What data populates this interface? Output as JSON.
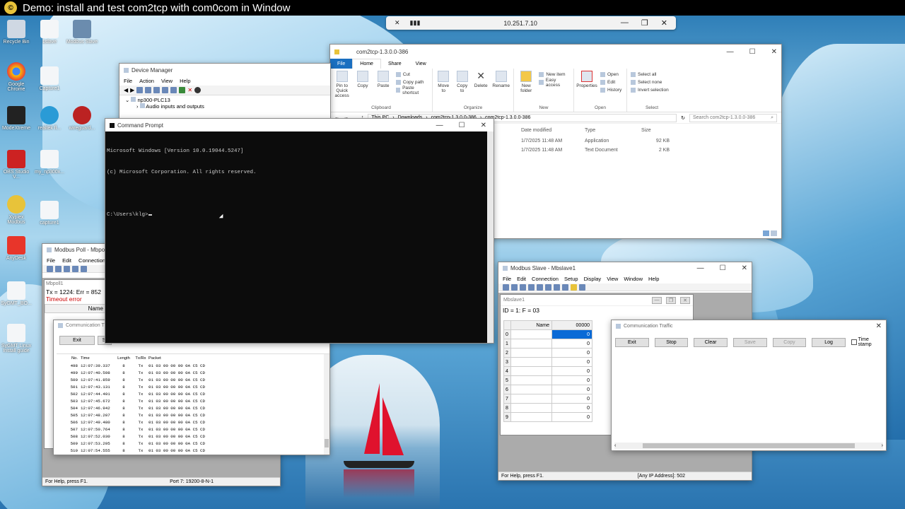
{
  "video_title": "Demo: install and test com2tcp with com0com in Window",
  "vpn_bar": {
    "ip": "10.251.7.10"
  },
  "desktop_icons": [
    {
      "label": "Recycle Bin"
    },
    {
      "label": "1slave"
    },
    {
      "label": "Modbus Slave"
    },
    {
      "label": "Google Chrome"
    },
    {
      "label": "Capture1"
    },
    {
      "label": "ModeXtreme"
    },
    {
      "label": "realtek fl..."
    },
    {
      "label": "wireguard..."
    },
    {
      "label": "OBS Studio V..."
    },
    {
      "label": "my_np300x..."
    },
    {
      "label": "Xyplex Modbus"
    },
    {
      "label": "capture1"
    },
    {
      "label": "AnyDesk"
    },
    {
      "label": "SyGMT_BO..."
    },
    {
      "label": "SyGMT Linux Install guide"
    }
  ],
  "device_manager": {
    "title": "Device Manager",
    "menu": [
      "File",
      "Action",
      "View",
      "Help"
    ],
    "tree": [
      "np300-PLC13",
      "Audio inputs and outputs"
    ]
  },
  "cmd": {
    "title": "Command Prompt",
    "lines": [
      "Microsoft Windows [Version 10.0.19044.5247]",
      "(c) Microsoft Corporation. All rights reserved.",
      "",
      "C:\\Users\\klg>"
    ]
  },
  "explorer": {
    "title": "com2tcp-1.3.0.0-386",
    "tabs": [
      "File",
      "Home",
      "Share",
      "View"
    ],
    "ribbon": {
      "clipboard": {
        "name": "Clipboard",
        "pin": "Pin to Quick access",
        "copy": "Copy",
        "paste": "Paste",
        "cut": "Cut",
        "copy_path": "Copy path",
        "paste_shortcut": "Paste shortcut"
      },
      "organize": {
        "name": "Organize",
        "move": "Move to",
        "copy": "Copy to",
        "delete": "Delete",
        "rename": "Rename"
      },
      "new": {
        "name": "New",
        "new_folder": "New folder",
        "new_item": "New item",
        "easy_access": "Easy access"
      },
      "open": {
        "name": "Open",
        "properties": "Properties",
        "open": "Open",
        "edit": "Edit",
        "history": "History"
      },
      "select": {
        "name": "Select",
        "all": "Select all",
        "none": "Select none",
        "invert": "Invert selection"
      }
    },
    "breadcrumb": [
      "This PC",
      "Downloads",
      "com2tcp-1.3.0.0-386",
      "com2tcp-1.3.0.0-386"
    ],
    "search_placeholder": "Search com2tcp-1.3.0.0-386",
    "columns": [
      "Date modified",
      "Type",
      "Size"
    ],
    "rows": [
      {
        "date": "1/7/2025 11:48 AM",
        "type": "Application",
        "size": "92 KB"
      },
      {
        "date": "1/7/2025 11:48 AM",
        "type": "Text Document",
        "size": "2 KB"
      }
    ]
  },
  "mbpoll": {
    "title": "Modbus Poll - Mbpoll",
    "menu": [
      "File",
      "Edit",
      "Connection",
      "S"
    ],
    "child_title": "Mbpoll1",
    "stat": "Tx = 1224: Err = 852",
    "error": "Timeout error",
    "name_header": "Name",
    "status_left": "For Help, press F1.",
    "status_right": "Port 7: 19200-8-N-1",
    "traffic": {
      "title": "Communication T",
      "exit": "Exit",
      "stop": "St",
      "columns": [
        "No.",
        "Time",
        "Length",
        "Tx/Rx",
        "Packet"
      ],
      "rows": [
        {
          "no": "498",
          "time": "12:07:39.337",
          "len": "8",
          "dir": "Tx",
          "pkt": "01 03 00 00 00 0A C5 CD"
        },
        {
          "no": "499",
          "time": "12:07:40.598",
          "len": "8",
          "dir": "Tx",
          "pkt": "01 03 00 00 00 0A C5 CD"
        },
        {
          "no": "500",
          "time": "12:07:41.859",
          "len": "8",
          "dir": "Tx",
          "pkt": "01 03 00 00 00 0A C5 CD"
        },
        {
          "no": "501",
          "time": "12:07:43.131",
          "len": "8",
          "dir": "Tx",
          "pkt": "01 03 00 00 00 0A C5 CD"
        },
        {
          "no": "502",
          "time": "12:07:44.401",
          "len": "8",
          "dir": "Tx",
          "pkt": "01 03 00 00 00 0A C5 CD"
        },
        {
          "no": "503",
          "time": "12:07:45.672",
          "len": "8",
          "dir": "Tx",
          "pkt": "01 03 00 00 00 0A C5 CD"
        },
        {
          "no": "504",
          "time": "12:07:46.942",
          "len": "8",
          "dir": "Tx",
          "pkt": "01 03 00 00 00 0A C5 CD"
        },
        {
          "no": "505",
          "time": "12:07:48.207",
          "len": "8",
          "dir": "Tx",
          "pkt": "01 03 00 00 00 0A C5 CD"
        },
        {
          "no": "506",
          "time": "12:07:49.480",
          "len": "8",
          "dir": "Tx",
          "pkt": "01 03 00 00 00 0A C5 CD"
        },
        {
          "no": "507",
          "time": "12:07:50.764",
          "len": "8",
          "dir": "Tx",
          "pkt": "01 03 00 00 00 0A C5 CD"
        },
        {
          "no": "508",
          "time": "12:07:52.030",
          "len": "8",
          "dir": "Tx",
          "pkt": "01 03 00 00 00 0A C5 CD"
        },
        {
          "no": "509",
          "time": "12:07:53.295",
          "len": "8",
          "dir": "Tx",
          "pkt": "01 03 00 00 00 0A C5 CD"
        },
        {
          "no": "510",
          "time": "12:07:54.555",
          "len": "8",
          "dir": "Tx",
          "pkt": "01 03 00 00 00 0A C5 CD"
        }
      ]
    }
  },
  "mbslave": {
    "title": "Modbus Slave - Mbslave1",
    "menu": [
      "File",
      "Edit",
      "Connection",
      "Setup",
      "Display",
      "View",
      "Window",
      "Help"
    ],
    "child_title": "Mbslave1",
    "id_line": "ID = 1: F = 03",
    "name_header": "Name",
    "value_header": "00000",
    "rows": [
      {
        "idx": "0",
        "val": "0"
      },
      {
        "idx": "1",
        "val": "0"
      },
      {
        "idx": "2",
        "val": "0"
      },
      {
        "idx": "3",
        "val": "0"
      },
      {
        "idx": "4",
        "val": "0"
      },
      {
        "idx": "5",
        "val": "0"
      },
      {
        "idx": "6",
        "val": "0"
      },
      {
        "idx": "7",
        "val": "0"
      },
      {
        "idx": "8",
        "val": "0"
      },
      {
        "idx": "9",
        "val": "0"
      }
    ],
    "status_left": "For Help, press F1.",
    "status_right": "[Any IP Address]: 502",
    "traffic": {
      "title": "Communication Traffic",
      "buttons": {
        "exit": "Exit",
        "stop": "Stop",
        "clear": "Clear",
        "save": "Save",
        "copy": "Copy",
        "log": "Log"
      },
      "timestamp": "Time stamp"
    }
  }
}
